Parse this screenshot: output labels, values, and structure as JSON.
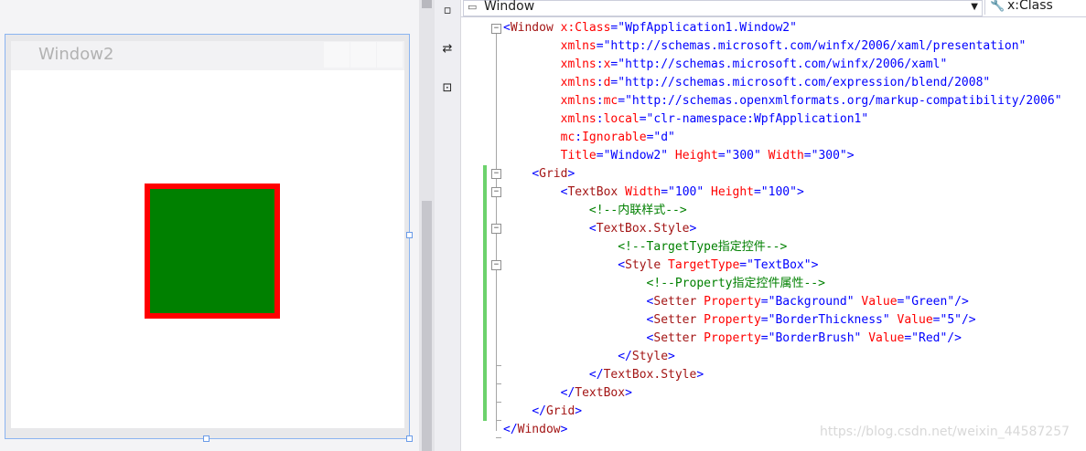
{
  "designer": {
    "window_title": "Window2",
    "preview_colors": {
      "background": "#008000",
      "border": "#ff0000"
    }
  },
  "nav": {
    "element_selector": "Window",
    "member_selector": "x:Class"
  },
  "code_lines": [
    [
      [
        "b",
        "<"
      ],
      [
        "e",
        "Window"
      ],
      [
        "a",
        " x:Class"
      ],
      [
        "b",
        "=\""
      ],
      [
        "v",
        "WpfApplication1.Window2"
      ],
      [
        "b",
        "\""
      ]
    ],
    [
      [
        "t",
        "        "
      ],
      [
        "a",
        "xmlns"
      ],
      [
        "b",
        "=\""
      ],
      [
        "v",
        "http://schemas.microsoft.com/winfx/2006/xaml/presentation"
      ],
      [
        "b",
        "\""
      ]
    ],
    [
      [
        "t",
        "        "
      ],
      [
        "a",
        "xmlns"
      ],
      [
        "b",
        ":"
      ],
      [
        "a",
        "x"
      ],
      [
        "b",
        "=\""
      ],
      [
        "v",
        "http://schemas.microsoft.com/winfx/2006/xaml"
      ],
      [
        "b",
        "\""
      ]
    ],
    [
      [
        "t",
        "        "
      ],
      [
        "a",
        "xmlns"
      ],
      [
        "b",
        ":"
      ],
      [
        "a",
        "d"
      ],
      [
        "b",
        "=\""
      ],
      [
        "v",
        "http://schemas.microsoft.com/expression/blend/2008"
      ],
      [
        "b",
        "\""
      ]
    ],
    [
      [
        "t",
        "        "
      ],
      [
        "a",
        "xmlns"
      ],
      [
        "b",
        ":"
      ],
      [
        "a",
        "mc"
      ],
      [
        "b",
        "=\""
      ],
      [
        "v",
        "http://schemas.openxmlformats.org/markup-compatibility/2006"
      ],
      [
        "b",
        "\""
      ]
    ],
    [
      [
        "t",
        "        "
      ],
      [
        "a",
        "xmlns"
      ],
      [
        "b",
        ":"
      ],
      [
        "a",
        "local"
      ],
      [
        "b",
        "=\""
      ],
      [
        "v",
        "clr-namespace:WpfApplication1"
      ],
      [
        "b",
        "\""
      ]
    ],
    [
      [
        "t",
        "        "
      ],
      [
        "a",
        "mc"
      ],
      [
        "b",
        ":"
      ],
      [
        "a",
        "Ignorable"
      ],
      [
        "b",
        "=\""
      ],
      [
        "v",
        "d"
      ],
      [
        "b",
        "\""
      ]
    ],
    [
      [
        "t",
        "        "
      ],
      [
        "a",
        "Title"
      ],
      [
        "b",
        "=\""
      ],
      [
        "v",
        "Window2"
      ],
      [
        "b",
        "\""
      ],
      [
        "a",
        " Height"
      ],
      [
        "b",
        "=\""
      ],
      [
        "v",
        "300"
      ],
      [
        "b",
        "\""
      ],
      [
        "a",
        " Width"
      ],
      [
        "b",
        "=\""
      ],
      [
        "v",
        "300"
      ],
      [
        "b",
        "\">"
      ]
    ],
    [
      [
        "t",
        "    "
      ],
      [
        "b",
        "<"
      ],
      [
        "e",
        "Grid"
      ],
      [
        "b",
        ">"
      ]
    ],
    [
      [
        "t",
        "        "
      ],
      [
        "b",
        "<"
      ],
      [
        "e",
        "TextBox"
      ],
      [
        "a",
        " Width"
      ],
      [
        "b",
        "=\""
      ],
      [
        "v",
        "100"
      ],
      [
        "b",
        "\""
      ],
      [
        "a",
        " Height"
      ],
      [
        "b",
        "=\""
      ],
      [
        "v",
        "100"
      ],
      [
        "b",
        "\">"
      ]
    ],
    [
      [
        "t",
        "            "
      ],
      [
        "c",
        "<!--内联样式-->"
      ]
    ],
    [
      [
        "t",
        "            "
      ],
      [
        "b",
        "<"
      ],
      [
        "e",
        "TextBox.Style"
      ],
      [
        "b",
        ">"
      ]
    ],
    [
      [
        "t",
        "                "
      ],
      [
        "c",
        "<!--TargetType指定控件-->"
      ]
    ],
    [
      [
        "t",
        "                "
      ],
      [
        "b",
        "<"
      ],
      [
        "e",
        "Style"
      ],
      [
        "a",
        " TargetType"
      ],
      [
        "b",
        "=\""
      ],
      [
        "v",
        "TextBox"
      ],
      [
        "b",
        "\">"
      ]
    ],
    [
      [
        "t",
        "                    "
      ],
      [
        "c",
        "<!--Property指定控件属性-->"
      ]
    ],
    [
      [
        "t",
        "                    "
      ],
      [
        "b",
        "<"
      ],
      [
        "e",
        "Setter"
      ],
      [
        "a",
        " Property"
      ],
      [
        "b",
        "=\""
      ],
      [
        "v",
        "Background"
      ],
      [
        "b",
        "\""
      ],
      [
        "a",
        " Value"
      ],
      [
        "b",
        "=\""
      ],
      [
        "v",
        "Green"
      ],
      [
        "b",
        "\"/>"
      ]
    ],
    [
      [
        "t",
        "                    "
      ],
      [
        "b",
        "<"
      ],
      [
        "e",
        "Setter"
      ],
      [
        "a",
        " Property"
      ],
      [
        "b",
        "=\""
      ],
      [
        "v",
        "BorderThickness"
      ],
      [
        "b",
        "\""
      ],
      [
        "a",
        " Value"
      ],
      [
        "b",
        "=\""
      ],
      [
        "v",
        "5"
      ],
      [
        "b",
        "\"/>"
      ]
    ],
    [
      [
        "t",
        "                    "
      ],
      [
        "b",
        "<"
      ],
      [
        "e",
        "Setter"
      ],
      [
        "a",
        " Property"
      ],
      [
        "b",
        "=\""
      ],
      [
        "v",
        "BorderBrush"
      ],
      [
        "b",
        "\""
      ],
      [
        "a",
        " Value"
      ],
      [
        "b",
        "=\""
      ],
      [
        "v",
        "Red"
      ],
      [
        "b",
        "\"/>"
      ]
    ],
    [
      [
        "t",
        "                "
      ],
      [
        "b",
        "</"
      ],
      [
        "e",
        "Style"
      ],
      [
        "b",
        ">"
      ]
    ],
    [
      [
        "t",
        "            "
      ],
      [
        "b",
        "</"
      ],
      [
        "e",
        "TextBox.Style"
      ],
      [
        "b",
        ">"
      ]
    ],
    [
      [
        "t",
        "        "
      ],
      [
        "b",
        "</"
      ],
      [
        "e",
        "TextBox"
      ],
      [
        "b",
        ">"
      ]
    ],
    [
      [
        "t",
        "    "
      ],
      [
        "b",
        "</"
      ],
      [
        "e",
        "Grid"
      ],
      [
        "b",
        ">"
      ]
    ],
    [
      [
        "b",
        "</"
      ],
      [
        "e",
        "Window"
      ],
      [
        "b",
        ">"
      ]
    ]
  ],
  "watermark": "https://blog.csdn.net/weixin_44587257"
}
